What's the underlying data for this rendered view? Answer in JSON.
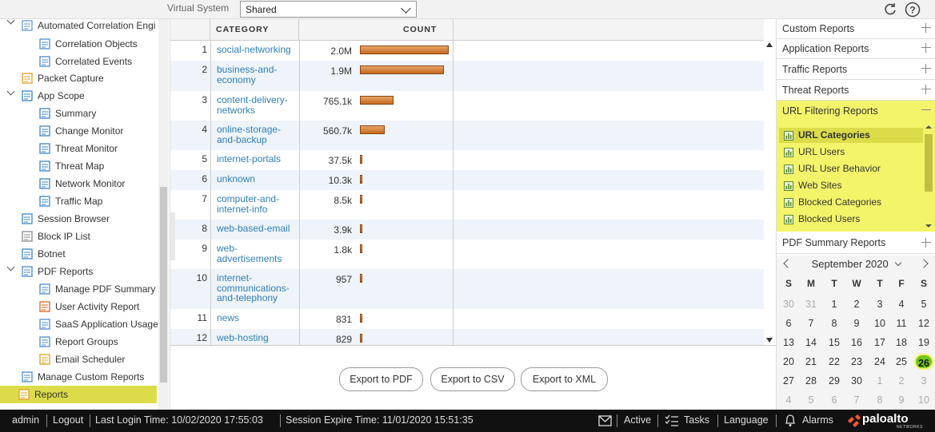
{
  "topbar": {
    "virtual_system_label": "Virtual System",
    "virtual_system_value": "Shared"
  },
  "nav": {
    "items": [
      {
        "label": "Automated Correlation Engi",
        "icon": "correlation-engine-icon"
      },
      {
        "label": "Correlation Objects",
        "icon": "correlation-objects-icon"
      },
      {
        "label": "Correlated Events",
        "icon": "correlated-events-icon"
      },
      {
        "label": "Packet Capture",
        "icon": "packet-capture-icon"
      },
      {
        "label": "App Scope",
        "icon": "app-scope-icon"
      },
      {
        "label": "Summary",
        "icon": "summary-icon"
      },
      {
        "label": "Change Monitor",
        "icon": "change-monitor-icon"
      },
      {
        "label": "Threat Monitor",
        "icon": "threat-monitor-icon"
      },
      {
        "label": "Threat Map",
        "icon": "threat-map-icon"
      },
      {
        "label": "Network Monitor",
        "icon": "network-monitor-icon"
      },
      {
        "label": "Traffic Map",
        "icon": "traffic-map-icon"
      },
      {
        "label": "Session Browser",
        "icon": "session-browser-icon"
      },
      {
        "label": "Block IP List",
        "icon": "block-ip-icon"
      },
      {
        "label": "Botnet",
        "icon": "botnet-icon"
      },
      {
        "label": "PDF Reports",
        "icon": "pdf-reports-icon"
      },
      {
        "label": "Manage PDF Summary",
        "icon": "pdf-summary-icon"
      },
      {
        "label": "User Activity Report",
        "icon": "user-activity-icon"
      },
      {
        "label": "SaaS Application Usage",
        "icon": "saas-usage-icon"
      },
      {
        "label": "Report Groups",
        "icon": "report-groups-icon"
      },
      {
        "label": "Email Scheduler",
        "icon": "email-scheduler-icon"
      },
      {
        "label": "Manage Custom Reports",
        "icon": "custom-reports-icon"
      },
      {
        "label": "Reports",
        "icon": "reports-icon"
      }
    ]
  },
  "table": {
    "headers": {
      "category": "CATEGORY",
      "count": "COUNT"
    },
    "rows": [
      {
        "num": "1",
        "category": "social-networking",
        "count": "2.0M",
        "value": 2000000
      },
      {
        "num": "2",
        "category": "business-and-economy",
        "count": "1.9M",
        "value": 1900000
      },
      {
        "num": "3",
        "category": "content-delivery-networks",
        "count": "765.1k",
        "value": 765100
      },
      {
        "num": "4",
        "category": "online-storage-and-backup",
        "count": "560.7k",
        "value": 560700
      },
      {
        "num": "5",
        "category": "internet-portals",
        "count": "37.5k",
        "value": 37500
      },
      {
        "num": "6",
        "category": "unknown",
        "count": "10.3k",
        "value": 10300
      },
      {
        "num": "7",
        "category": "computer-and-internet-info",
        "count": "8.5k",
        "value": 8500
      },
      {
        "num": "8",
        "category": "web-based-email",
        "count": "3.9k",
        "value": 3900
      },
      {
        "num": "9",
        "category": "web-advertisements",
        "count": "1.8k",
        "value": 1800
      },
      {
        "num": "10",
        "category": "internet-communications-and-telephony",
        "count": "957",
        "value": 957
      },
      {
        "num": "11",
        "category": "news",
        "count": "831",
        "value": 831
      },
      {
        "num": "12",
        "category": "web-hosting",
        "count": "829",
        "value": 829
      }
    ]
  },
  "buttons": {
    "export_pdf": "Export to PDF",
    "export_csv": "Export to CSV",
    "export_xml": "Export to XML"
  },
  "right_panel": {
    "sections": {
      "custom": "Custom Reports",
      "application": "Application Reports",
      "traffic": "Traffic Reports",
      "threat": "Threat Reports",
      "url_filtering": "URL Filtering Reports",
      "pdf_summary": "PDF Summary Reports"
    },
    "url_items": [
      "URL Categories",
      "URL Users",
      "URL User Behavior",
      "Web Sites",
      "Blocked Categories",
      "Blocked Users"
    ],
    "selected_item": "URL Categories"
  },
  "calendar": {
    "month_label": "September 2020",
    "dow": [
      "S",
      "M",
      "T",
      "W",
      "T",
      "F",
      "S"
    ],
    "weeks": [
      [
        "30",
        "31",
        "1",
        "2",
        "3",
        "4",
        "5"
      ],
      [
        "6",
        "7",
        "8",
        "9",
        "10",
        "11",
        "12"
      ],
      [
        "13",
        "14",
        "15",
        "16",
        "17",
        "18",
        "19"
      ],
      [
        "20",
        "21",
        "22",
        "23",
        "24",
        "25",
        "26"
      ],
      [
        "27",
        "28",
        "29",
        "30",
        "1",
        "2",
        "3"
      ],
      [
        "4",
        "5",
        "6",
        "7",
        "8",
        "9",
        "10"
      ]
    ],
    "today": "26"
  },
  "status": {
    "user": "admin",
    "logout": "Logout",
    "last_login": "Last Login Time: 10/02/2020 17:55:03",
    "session_expire": "Session Expire Time: 11/01/2020 15:51:35",
    "active": "Active",
    "tasks": "Tasks",
    "language": "Language",
    "alarms": "Alarms",
    "brand": "paloalto",
    "brand_sub": "NETWORKS"
  },
  "colors": {
    "highlight": "#f4f46a",
    "active_nav": "#dcdc4a",
    "link": "#2e7fb8",
    "bar": "#c56a1d",
    "today": "#74c61a"
  }
}
